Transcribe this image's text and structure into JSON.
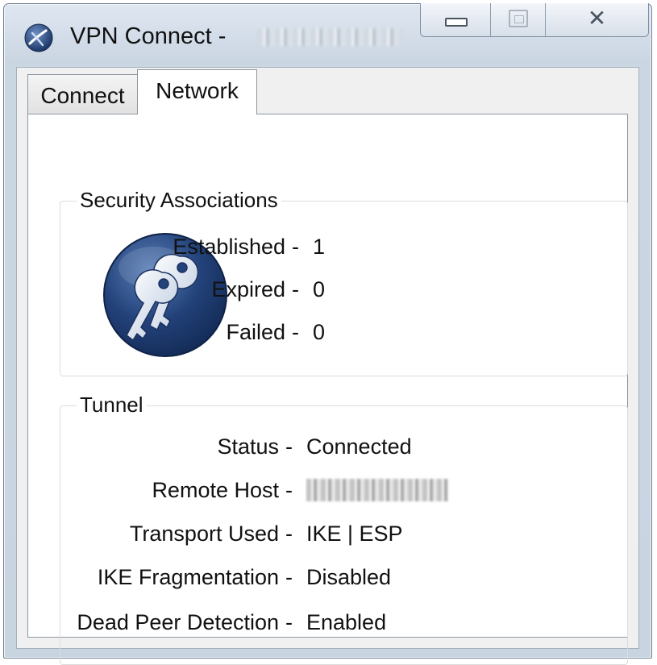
{
  "window": {
    "title": "VPN Connect -",
    "icon": "vpn-globe-icon",
    "caption_buttons": [
      "minimize",
      "maximize",
      "close"
    ],
    "close_glyph": "✕"
  },
  "tabs": [
    {
      "label": "Connect",
      "selected": false
    },
    {
      "label": "Network",
      "selected": true
    }
  ],
  "security_associations": {
    "title": "Security Associations",
    "icon": "keys-icon",
    "separator": "-",
    "rows": [
      {
        "label": "Established",
        "value": "1"
      },
      {
        "label": "Expired",
        "value": "0"
      },
      {
        "label": "Failed",
        "value": "0"
      }
    ]
  },
  "tunnel": {
    "title": "Tunnel",
    "separator": "-",
    "rows": [
      {
        "label": "Status",
        "value": "Connected"
      },
      {
        "label": "Remote Host",
        "value": ""
      },
      {
        "label": "Transport Used",
        "value": "IKE | ESP"
      },
      {
        "label": "IKE Fragmentation",
        "value": "Disabled"
      },
      {
        "label": "Dead Peer Detection",
        "value": "Enabled"
      }
    ]
  },
  "colors": {
    "frame": "#cbd6e3",
    "client_background": "#f0f0f0",
    "panel_background": "#ffffff",
    "icon_blue": "#1f3a6e"
  }
}
